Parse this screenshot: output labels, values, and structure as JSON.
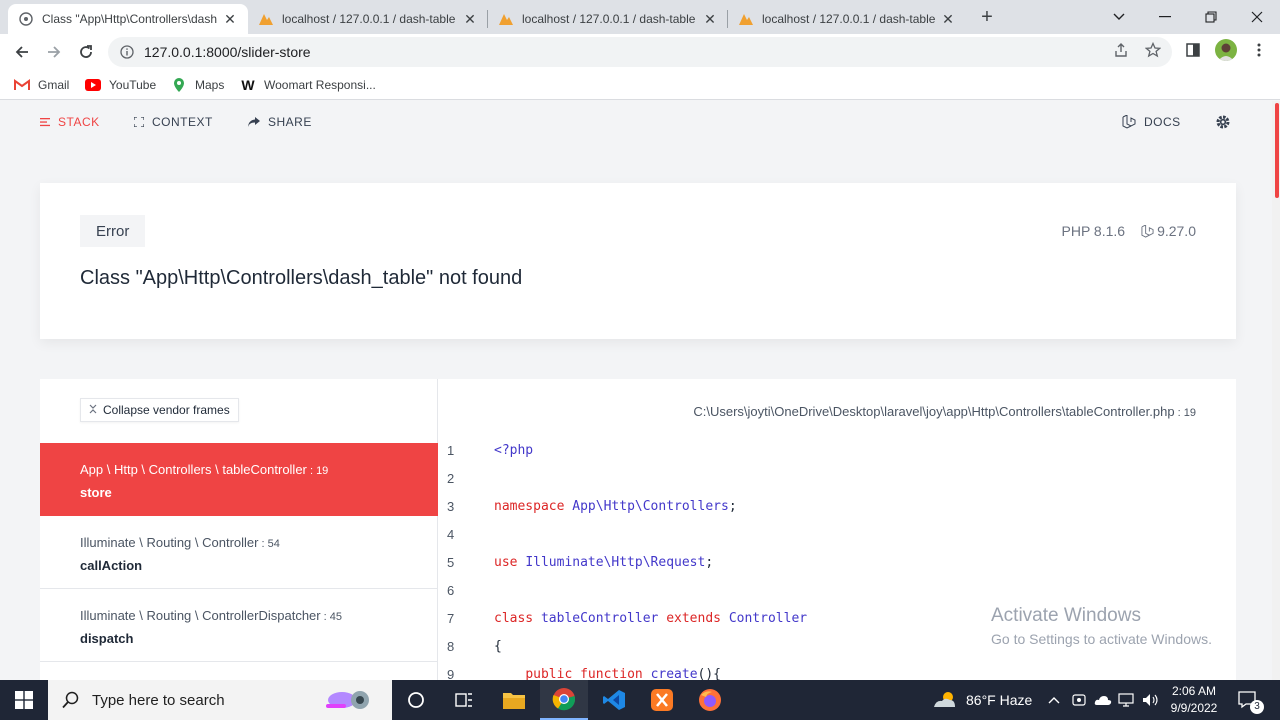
{
  "browser": {
    "tabs": [
      {
        "title": "Class \"App\\Http\\Controllers\\dash",
        "active": true
      },
      {
        "title": "localhost / 127.0.0.1 / dash-table",
        "active": false
      },
      {
        "title": "localhost / 127.0.0.1 / dash-table",
        "active": false
      },
      {
        "title": "localhost / 127.0.0.1 / dash-table",
        "active": false
      }
    ],
    "url": "127.0.0.1:8000/slider-store",
    "bookmarks": [
      {
        "label": "Gmail",
        "icon": "gmail-icon"
      },
      {
        "label": "YouTube",
        "icon": "youtube-icon"
      },
      {
        "label": "Maps",
        "icon": "maps-icon"
      },
      {
        "label": "Woomart Responsi...",
        "icon": "woomart-icon"
      }
    ]
  },
  "nav": {
    "stack": "STACK",
    "context": "CONTEXT",
    "share": "SHARE",
    "docs": "DOCS"
  },
  "error": {
    "badge": "Error",
    "message": "Class \"App\\Http\\Controllers\\dash_table\" not found",
    "php_version": "PHP 8.1.6",
    "laravel_version": "9.27.0"
  },
  "stack": {
    "collapse_label": "Collapse vendor frames",
    "frames": [
      {
        "path": "App \\ Http \\ Controllers \\ tableController",
        "line": "19",
        "method": "store"
      },
      {
        "path": "Illuminate \\ Routing \\ Controller",
        "line": "54",
        "method": "callAction"
      },
      {
        "path": "Illuminate \\ Routing \\ ControllerDispatcher",
        "line": "45",
        "method": "dispatch"
      }
    ],
    "file_path": "C:\\Users\\joyti\\OneDrive\\Desktop\\laravel\\joy\\app\\Http\\Controllers\\tableController.php",
    "file_line": "19",
    "code_line_numbers": [
      "1",
      "2",
      "3",
      "4",
      "5",
      "6",
      "7",
      "8",
      "9"
    ]
  },
  "watermark": {
    "line1": "Activate Windows",
    "line2": "Go to Settings to activate Windows."
  },
  "taskbar": {
    "search_placeholder": "Type here to search",
    "weather": "86°F  Haze",
    "time": "2:06 AM",
    "date": "9/9/2022",
    "notifications": "3"
  },
  "colors": {
    "accent": "#ef4444",
    "keyword": "#dc2626",
    "type": "#4338ca"
  }
}
